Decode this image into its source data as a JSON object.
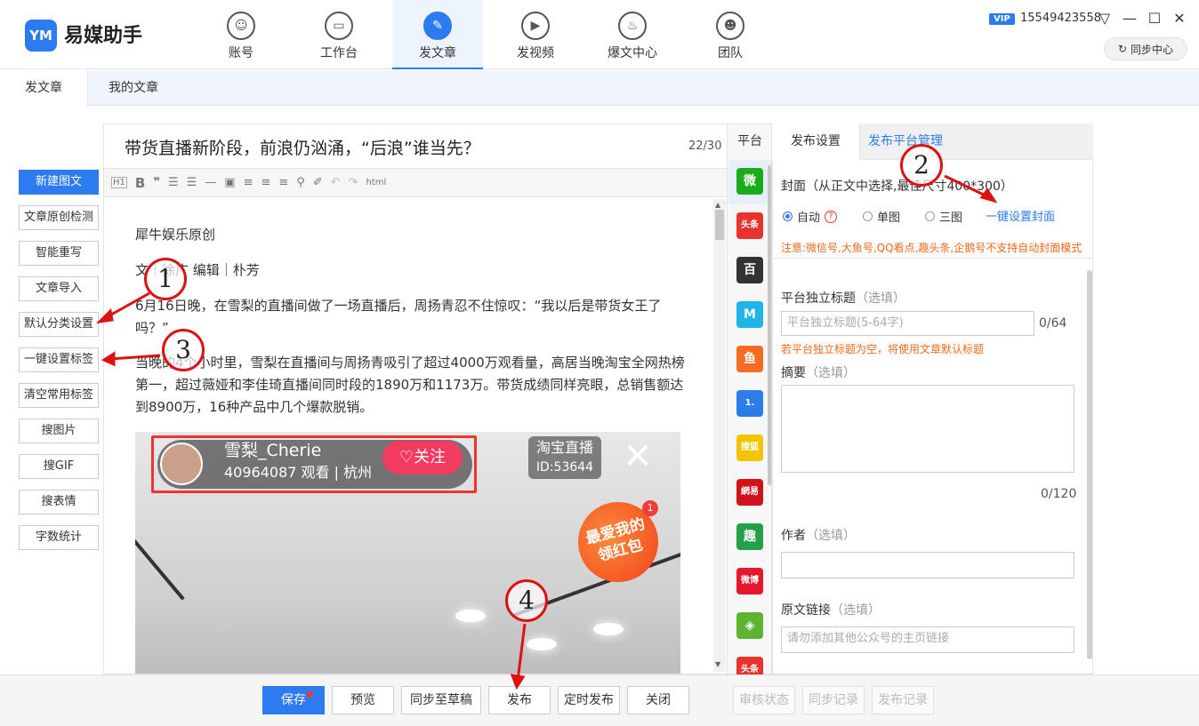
{
  "app": {
    "logo_text": "YM",
    "title": "易媒助手"
  },
  "nav": [
    {
      "label": "账号",
      "icon": "user-icon"
    },
    {
      "label": "工作台",
      "icon": "monitor-icon"
    },
    {
      "label": "发文章",
      "icon": "feather-icon",
      "active": true
    },
    {
      "label": "发视频",
      "icon": "play-icon"
    },
    {
      "label": "爆文中心",
      "icon": "flame-icon"
    },
    {
      "label": "团队",
      "icon": "team-icon"
    }
  ],
  "account": {
    "vip": "VIP",
    "phone": "15549423558",
    "sync_center": "同步中心"
  },
  "subtabs": [
    "发文章",
    "我的文章"
  ],
  "left_actions": [
    "新建图文",
    "文章原创检测",
    "智能重写",
    "文章导入",
    "默认分类设置",
    "一键设置标签",
    "清空常用标签",
    "搜图片",
    "搜GIF",
    "搜表情",
    "字数统计"
  ],
  "editor": {
    "title": "带货直播新阶段，前浪仍汹涌，“后浪”谁当先？",
    "title_count": "22/30",
    "toolbar_html": "html",
    "paragraphs": [
      "犀牛娱乐原创",
      "文｜徐广 编辑｜朴芳",
      "6月16日晚，在雪梨的直播间做了一场直播后，周扬青忍不住惊叹：“我以后是带货女王了吗？”",
      "当晚的4个小时里，雪梨在直播间与周扬青吸引了超过4000万观看量，高居当晚淘宝全网热榜第一，超过薇娅和李佳琦直播间同时段的1890万和1173万。带货成绩同样亮眼，总销售额达到8900万，16种产品中几个爆款脱销。"
    ],
    "image": {
      "streamer": "雪梨_Cherie",
      "viewers": "40964087 观看 |  杭州",
      "follow": "关注",
      "platform": "淘宝直播",
      "room_id": "ID:53644",
      "redpack": "最爱我的\n领红包",
      "redpack_badge": "1"
    }
  },
  "platforms": {
    "header": "平台",
    "items": [
      {
        "name": "wechat-icon",
        "text": "微",
        "color": "#1aad19"
      },
      {
        "name": "toutiao-icon",
        "text": "头条",
        "color": "#e8322d"
      },
      {
        "name": "baijia-icon",
        "text": "百",
        "color": "#333333"
      },
      {
        "name": "yidian-icon",
        "text": "M",
        "color": "#1fb5e8"
      },
      {
        "name": "dayu-icon",
        "text": "鱼",
        "color": "#f36c21"
      },
      {
        "name": "yidianzixun-icon",
        "text": "1.",
        "color": "#2b7de9"
      },
      {
        "name": "sohu-icon",
        "text": "搜狐",
        "color": "#f5c400"
      },
      {
        "name": "wangyi-icon",
        "text": "網易",
        "color": "#d0111b"
      },
      {
        "name": "qu-icon",
        "text": "趣",
        "color": "#24a147"
      },
      {
        "name": "weibo-icon",
        "text": "微博",
        "color": "#e6162d"
      },
      {
        "name": "aiqiyi-icon",
        "text": "◈",
        "color": "#5cb531"
      },
      {
        "name": "toutiao2-icon",
        "text": "头条",
        "color": "#e8322d"
      }
    ]
  },
  "settings": {
    "tabs": [
      "发布设置",
      "发布平台管理"
    ],
    "cover_label": "封面（从正文中选择,最佳尺寸400*300）",
    "cover_options": [
      "自动",
      "单图",
      "三图"
    ],
    "one_click_cover": "一键设置封面",
    "cover_note": "注意:微信号,大鱼号,QQ看点,趣头条,企鹅号不支持自动封面模式",
    "platform_title_label": "平台独立标题",
    "optional": "（选填）",
    "platform_title_placeholder": "平台独立标题(5-64字)",
    "platform_title_count": "0/64",
    "platform_title_note": "若平台独立标题为空，将使用文章默认标题",
    "summary_label": "摘要",
    "summary_count": "0/120",
    "author_label": "作者",
    "source_label": "原文链接",
    "source_placeholder": "请勿添加其他公众号的主页链接"
  },
  "bottom": {
    "buttons": [
      "保存",
      "预览",
      "同步至草稿",
      "发布",
      "定时发布",
      "关闭"
    ],
    "status_buttons": [
      "审核状态",
      "同步记录",
      "发布记录"
    ]
  },
  "annotations": [
    "1",
    "2",
    "3",
    "4"
  ]
}
